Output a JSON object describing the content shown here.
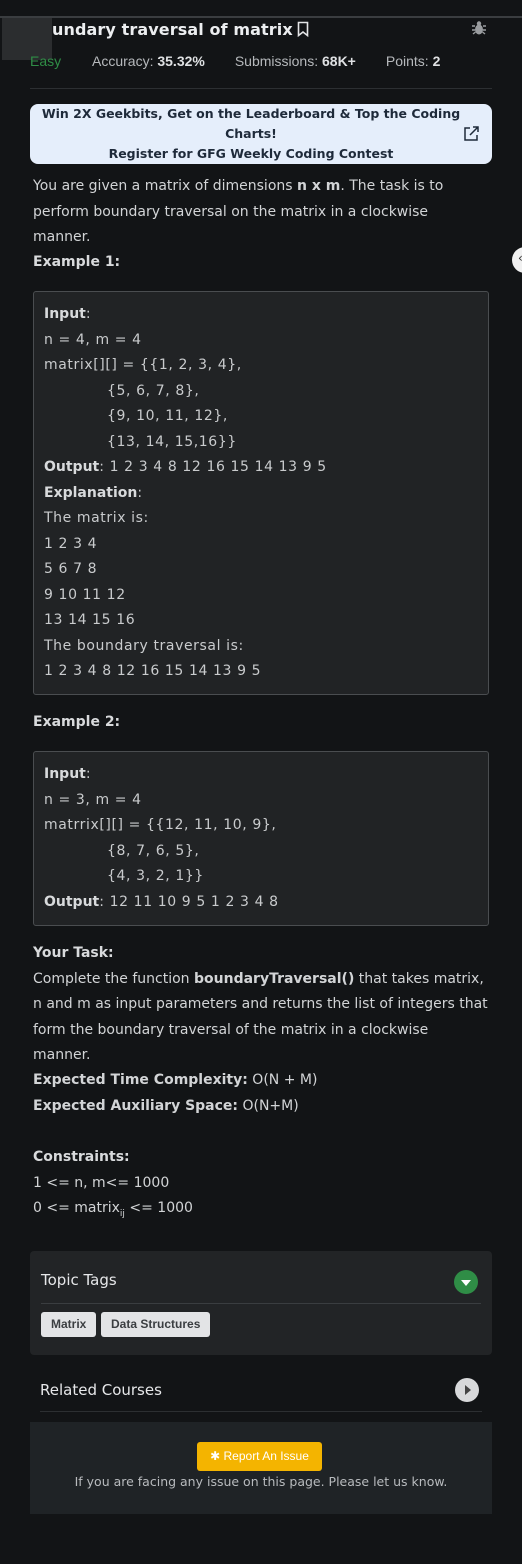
{
  "header": {
    "title": "undary traversal of matrix",
    "difficulty": "Easy",
    "accuracy_label": "Accuracy:",
    "accuracy_value": "35.32%",
    "submissions_label": "Submissions:",
    "submissions_value": "68K+",
    "points_label": "Points:",
    "points_value": "2"
  },
  "banner": {
    "line1": "Win 2X Geekbits, Get on the Leaderboard & Top the Coding Charts!",
    "line2": "Register for GFG Weekly Coding Contest"
  },
  "problem": {
    "intro_a": "You are given a matrix of dimensions ",
    "intro_b": "n x m",
    "intro_c": ". The task is to perform boundary traversal on the matrix in a clockwise manner."
  },
  "example1": {
    "heading": "Example 1:",
    "input_label": "Input",
    "lines": [
      "n = 4, m = 4",
      "matrix[][] = {{1, 2, 3, 4},",
      "{5, 6, 7, 8},",
      "{9, 10, 11, 12},",
      "{13, 14, 15,16}}"
    ],
    "output_label": "Output",
    "output": ": 1 2 3 4 8 12 16 15 14 13 9 5",
    "explanation_label": "Explanation",
    "explanation": [
      "The matrix is:",
      "1 2 3 4",
      "5 6 7 8",
      "9 10 11 12",
      "13 14 15 16",
      "The boundary traversal is:",
      "1 2 3 4 8 12 16 15 14 13 9 5"
    ]
  },
  "example2": {
    "heading": "Example 2:",
    "input_label": "Input",
    "lines": [
      "n = 3, m = 4",
      "matrrix[][] = {{12, 11, 10, 9},",
      "{8, 7, 6, 5},",
      "{4, 3, 2, 1}}"
    ],
    "output_label": "Output",
    "output": ": 12 11 10 9 5 1 2 3 4 8"
  },
  "task": {
    "heading": "Your Task:",
    "text_a": "Complete the function ",
    "func": "boundaryTraversal()",
    "text_b": " that takes matrix, n and m as input parameters and returns the list of integers that form the boundary traversal of the matrix in a clockwise manner."
  },
  "complexity": {
    "time_label": "Expected Time Complexity:",
    "time_value": " O(N + M)",
    "space_label": "Expected Auxiliary Space:",
    "space_value": " O(N+M)"
  },
  "constraints": {
    "heading": "Constraints:",
    "line1": "1 <= n, m<= 1000",
    "line2_a": "0 <= matrix",
    "line2_sub": "ij",
    "line2_b": " <= 1000"
  },
  "topic_tags": {
    "title": "Topic Tags",
    "tags": [
      "Matrix",
      "Data Structures"
    ]
  },
  "related": {
    "title": "Related Courses"
  },
  "footer": {
    "report_label": "Report An Issue",
    "note": "If you are facing any issue on this page. Please let us know."
  },
  "colors": {
    "accent_green": "#2f8d46",
    "report_yellow": "#f4b400",
    "banner_bg": "#e5eefb"
  },
  "icons": [
    "bookmark-icon",
    "bug-icon",
    "external-link-icon",
    "chevron-down-icon",
    "chevron-right-icon",
    "collapse-icon"
  ]
}
